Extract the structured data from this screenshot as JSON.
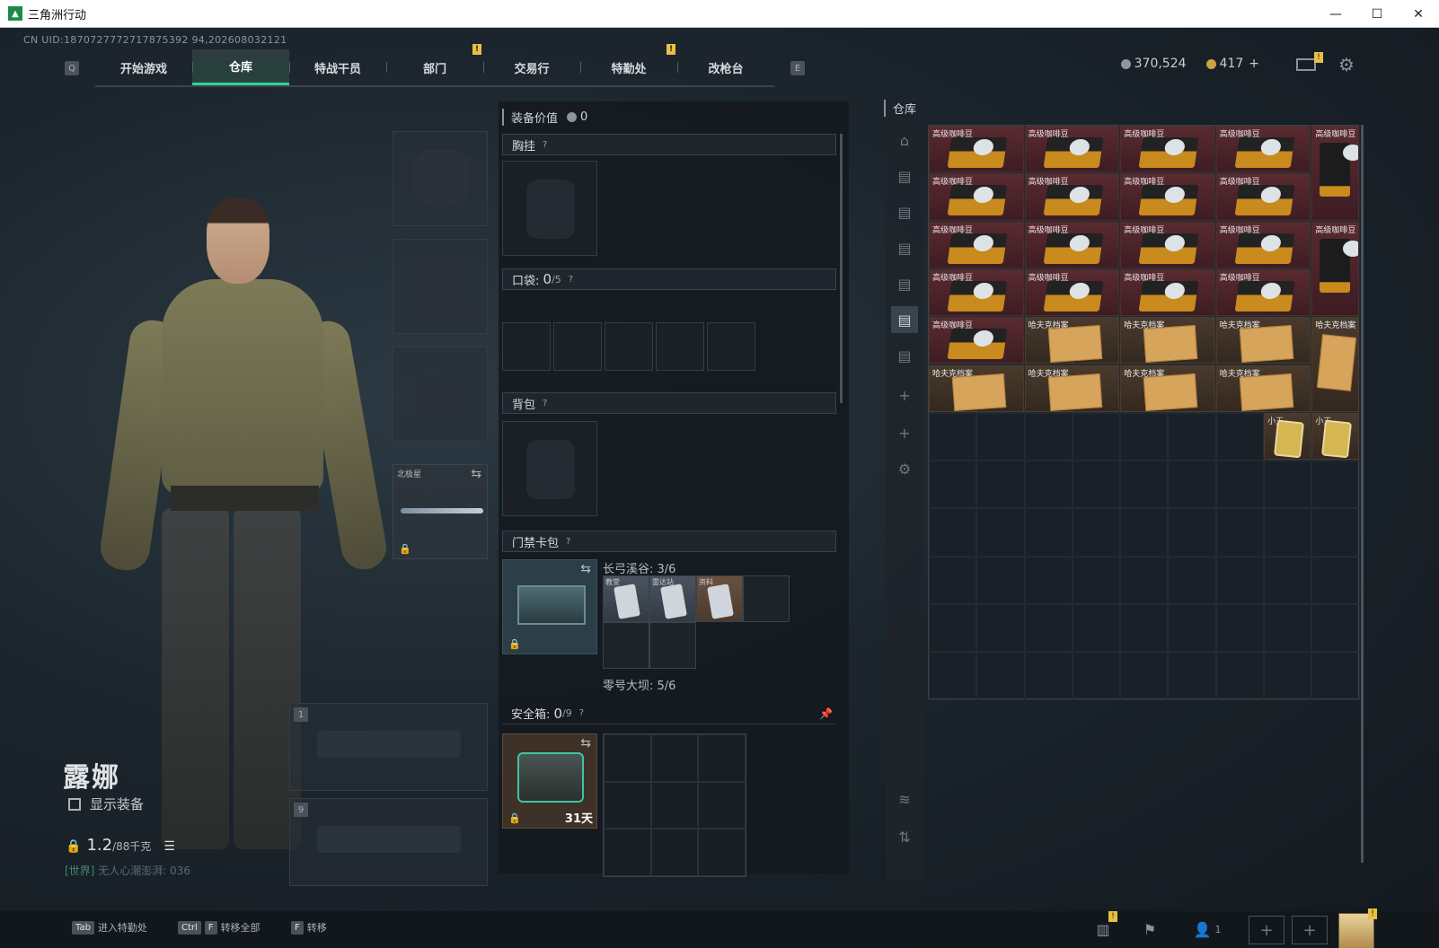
{
  "window": {
    "title": "三角洲行动",
    "minimize": "—",
    "maximize": "☐",
    "close": "✕"
  },
  "uid": "CN UID:1870727772717875392 94,202608032121",
  "nav": {
    "key_left": "Q",
    "key_right": "E",
    "tabs": [
      {
        "label": "开始游戏"
      },
      {
        "label": "仓库"
      },
      {
        "label": "特战干员"
      },
      {
        "label": "部门"
      },
      {
        "label": "交易行"
      },
      {
        "label": "特勤处"
      },
      {
        "label": "改枪台"
      }
    ],
    "active_tab": "仓库",
    "alert_mark": "!"
  },
  "currency": {
    "silver": "370,524",
    "gold": "417",
    "plus": "+"
  },
  "character": {
    "name": "露娜",
    "show_equipment": "显示装备",
    "weight": "1.2",
    "weight_unit": "/88千克",
    "world_tag": "[世界]",
    "world_chat": "无人心潮澎湃: 036"
  },
  "weapon_slots": {
    "melee_name": "北极星",
    "slot1": "1",
    "slot2": "9"
  },
  "mid": {
    "equip_value_label": "装备价值",
    "equip_value": "0",
    "chest_label": "胸挂",
    "pocket_label": "口袋:",
    "pocket_used": "0",
    "pocket_total": "/5",
    "backpack_label": "背包",
    "keycard_label": "门禁卡包",
    "question": "?",
    "map1": "长弓溪谷: 3/6",
    "map2": "零号大坝: 5/6",
    "keys": [
      {
        "label": "教堂"
      },
      {
        "label": "雷达站"
      },
      {
        "label": "资料"
      }
    ],
    "safe_label": "安全箱:",
    "safe_used": "0",
    "safe_total": "/9",
    "safe_days": "31天"
  },
  "warehouse": {
    "title": "仓库",
    "coffee_label": "高级咖啡豆",
    "file_label": "哈夫克档案",
    "card_label": "小王"
  },
  "bottom": {
    "hint1_key": "Tab",
    "hint1_label": "进入特勤处",
    "hint2_key1": "Ctrl",
    "hint2_key2": "F",
    "hint2_label": "转移全部",
    "hint3_key": "F",
    "hint3_label": "转移",
    "team_count": "1"
  }
}
